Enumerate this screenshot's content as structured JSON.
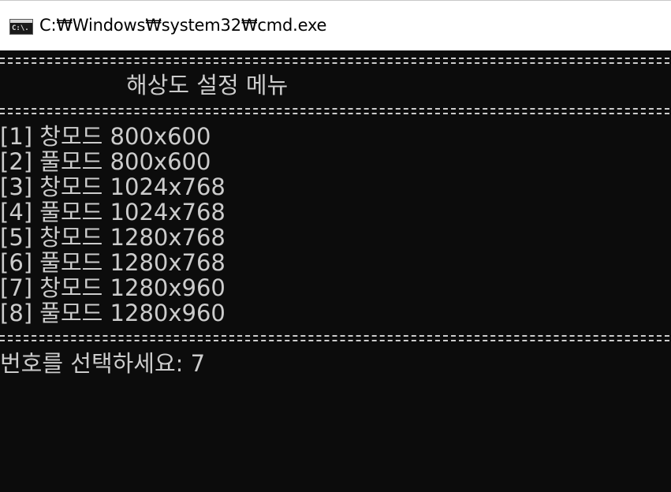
{
  "window": {
    "title": "C:₩Windows₩system32₩cmd.exe",
    "icon": "cmd-icon",
    "icon_text": "C:\\."
  },
  "console": {
    "menu_title": "해상도 설정 메뉴",
    "separator": "=====================================================================",
    "options": [
      "[1] 창모드 800x600",
      "[2] 풀모드 800x600",
      "[3] 창모드 1024x768",
      "[4] 풀모드 1024x768",
      "[5] 창모드 1280x768",
      "[6] 풀모드 1280x768",
      "[7] 창모드 1280x960",
      "[8] 풀모드 1280x960"
    ],
    "prompt": "번호를 선택하세요: 7"
  },
  "colors": {
    "console_bg": "#0c0c0c",
    "console_text": "#cccccc",
    "titlebar_bg": "#ffffff"
  }
}
